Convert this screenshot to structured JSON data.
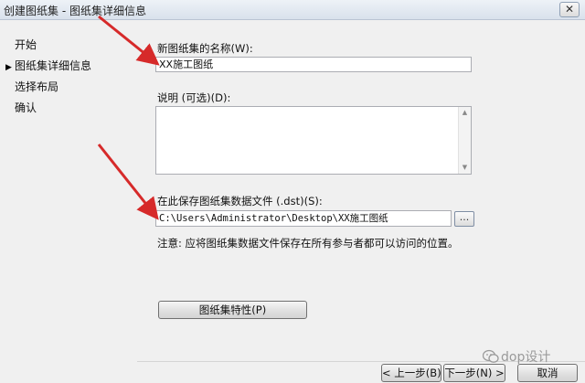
{
  "window": {
    "title": "创建图纸集 - 图纸集详细信息",
    "close_label": "✕"
  },
  "nav": {
    "items": [
      {
        "label": "开始",
        "active": false
      },
      {
        "label": "图纸集详细信息",
        "active": true
      },
      {
        "label": "选择布局",
        "active": false
      },
      {
        "label": "确认",
        "active": false
      }
    ],
    "active_marker": "▶"
  },
  "form": {
    "name_label": "新图纸集的名称(W):",
    "name_value": "XX施工图纸",
    "desc_label": "说明 (可选)(D):",
    "desc_value": "",
    "path_label": "在此保存图纸集数据文件 (.dst)(S):",
    "path_value": "C:\\Users\\Administrator\\Desktop\\XX施工图纸",
    "browse_label": "...",
    "note": "注意: 应将图纸集数据文件保存在所有参与者都可以访问的位置。",
    "properties_button": "图纸集特性(P)"
  },
  "footer": {
    "back_button": "< 上一步(B)",
    "next_button": "下一步(N) >",
    "cancel_button": "取消"
  },
  "watermark": {
    "text": "dop设计"
  },
  "colors": {
    "arrow": "#d62a2a",
    "titlebar_top": "#eef2f7",
    "titlebar_bottom": "#d9e1ec",
    "dialog_bg": "#f0f0f0"
  }
}
